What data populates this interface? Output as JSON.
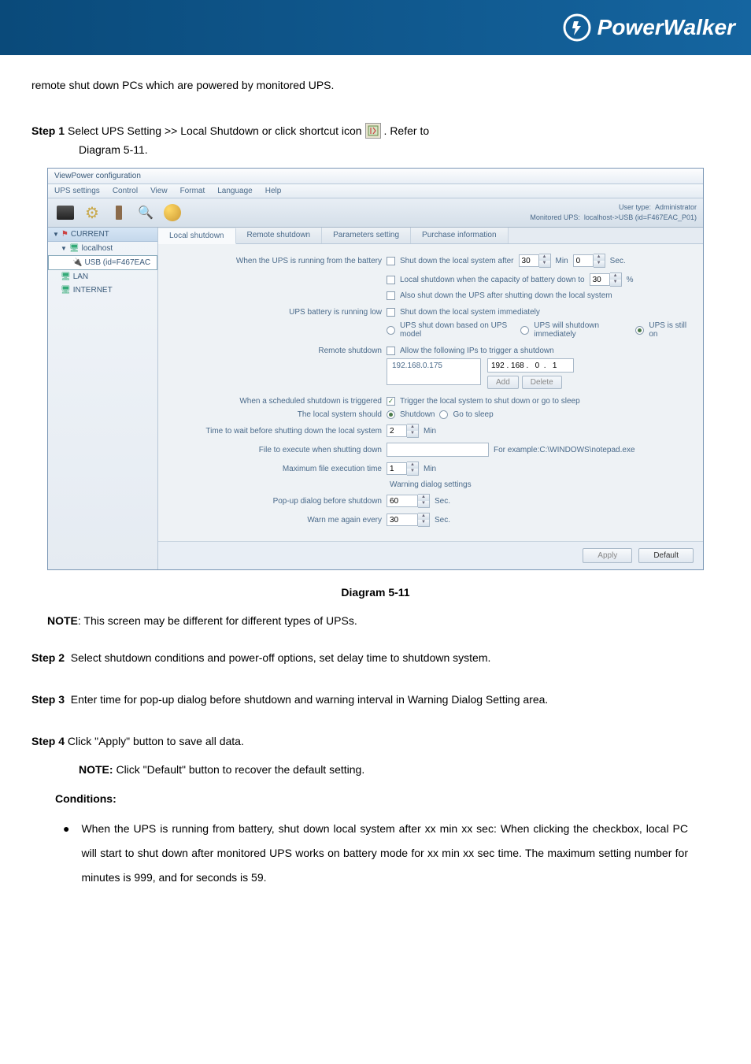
{
  "banner": {
    "brand": "PowerWalker"
  },
  "intro": "remote shut down PCs which are powered by monitored UPS.",
  "step1": {
    "label": "Step 1",
    "text_before": " Select UPS Setting >> Local Shutdown or click shortcut icon",
    "text_after": ". Refer to",
    "diagram_ref": "Diagram 5-11."
  },
  "window": {
    "title": "ViewPower configuration",
    "menu": [
      "UPS settings",
      "Control",
      "View",
      "Format",
      "Language",
      "Help"
    ],
    "user_type_label": "User type:",
    "user_type_value": "Administrator",
    "monitored_label": "Monitored UPS:",
    "monitored_value": "localhost->USB (id=F467EAC_P01)",
    "tree": {
      "root": "CURRENT",
      "n1": "localhost",
      "n2": "USB (id=F467EAC",
      "n3": "LAN",
      "n4": "INTERNET"
    },
    "tabs": [
      "Local shutdown",
      "Remote shutdown",
      "Parameters setting",
      "Purchase information"
    ],
    "form": {
      "l_battery": "When the UPS is running from the battery",
      "cb_shutlocal": "Shut down the local system after",
      "min_val": "30",
      "min_lbl": "Min",
      "sec_val": "0",
      "sec_lbl": "Sec.",
      "cb_capacity": "Local shutdown when the capacity of battery down to",
      "cap_val": "30",
      "pct": "%",
      "cb_alsoshut": "Also shut down the UPS after shutting down the local system",
      "l_batlow": "UPS battery is running low",
      "cb_shutimmed": "Shut down the local system immediately",
      "r_model": "UPS shut down based on UPS model",
      "r_immed": "UPS will shutdown immediately",
      "r_stillon": "UPS is still on",
      "l_remote": "Remote shutdown",
      "cb_allowip": "Allow the following IPs to trigger a shutdown",
      "ip_existing": "192.168.0.175",
      "ip_new": "192 . 168 .   0  .   1",
      "btn_add": "Add",
      "btn_delete": "Delete",
      "l_scheduled": "When a scheduled shutdown is triggered",
      "cb_trigger": "Trigger the local system to shut down or go to sleep",
      "l_localshould": "The local system should",
      "r_shutdown": "Shutdown",
      "r_sleep": "Go to sleep",
      "l_timewait": "Time to wait before shutting down the local system",
      "wait_val": "2",
      "wait_unit": "Min",
      "l_execute": "File to execute when shutting down",
      "exec_example": "For example:C:\\WINDOWS\\notepad.exe",
      "l_maxtime": "Maximum file execution time",
      "max_val": "1",
      "max_unit": "Min",
      "h_warning": "Warning dialog settings",
      "l_popup": "Pop-up dialog before shutdown",
      "popup_val": "60",
      "popup_unit": "Sec.",
      "l_warnme": "Warn me again every",
      "warn_val": "30",
      "warn_unit": "Sec.",
      "btn_apply": "Apply",
      "btn_default": "Default"
    }
  },
  "caption": "Diagram 5-11",
  "note1": {
    "label": "NOTE",
    "text": ": This screen may be different for different types of UPSs."
  },
  "step2": {
    "label": "Step 2",
    "text": "Select shutdown conditions and power-off options, set delay time to shutdown system."
  },
  "step3": {
    "label": "Step 3",
    "text": "Enter time for pop-up dialog before shutdown and warning interval in Warning Dialog Setting area."
  },
  "step4": {
    "label": "Step 4",
    "text": " Click \"Apply\" button to save all data."
  },
  "note2": {
    "label": "NOTE:",
    "text": " Click \"Default\" button to recover the default setting."
  },
  "conditions_label": "Conditions:",
  "bullet1": "When the UPS is running from battery, shut down local system after xx min xx sec: When clicking the checkbox, local PC will start to shut down after monitored UPS works on battery mode for xx min xx sec time. The maximum setting number for minutes is 999, and for seconds is 59."
}
